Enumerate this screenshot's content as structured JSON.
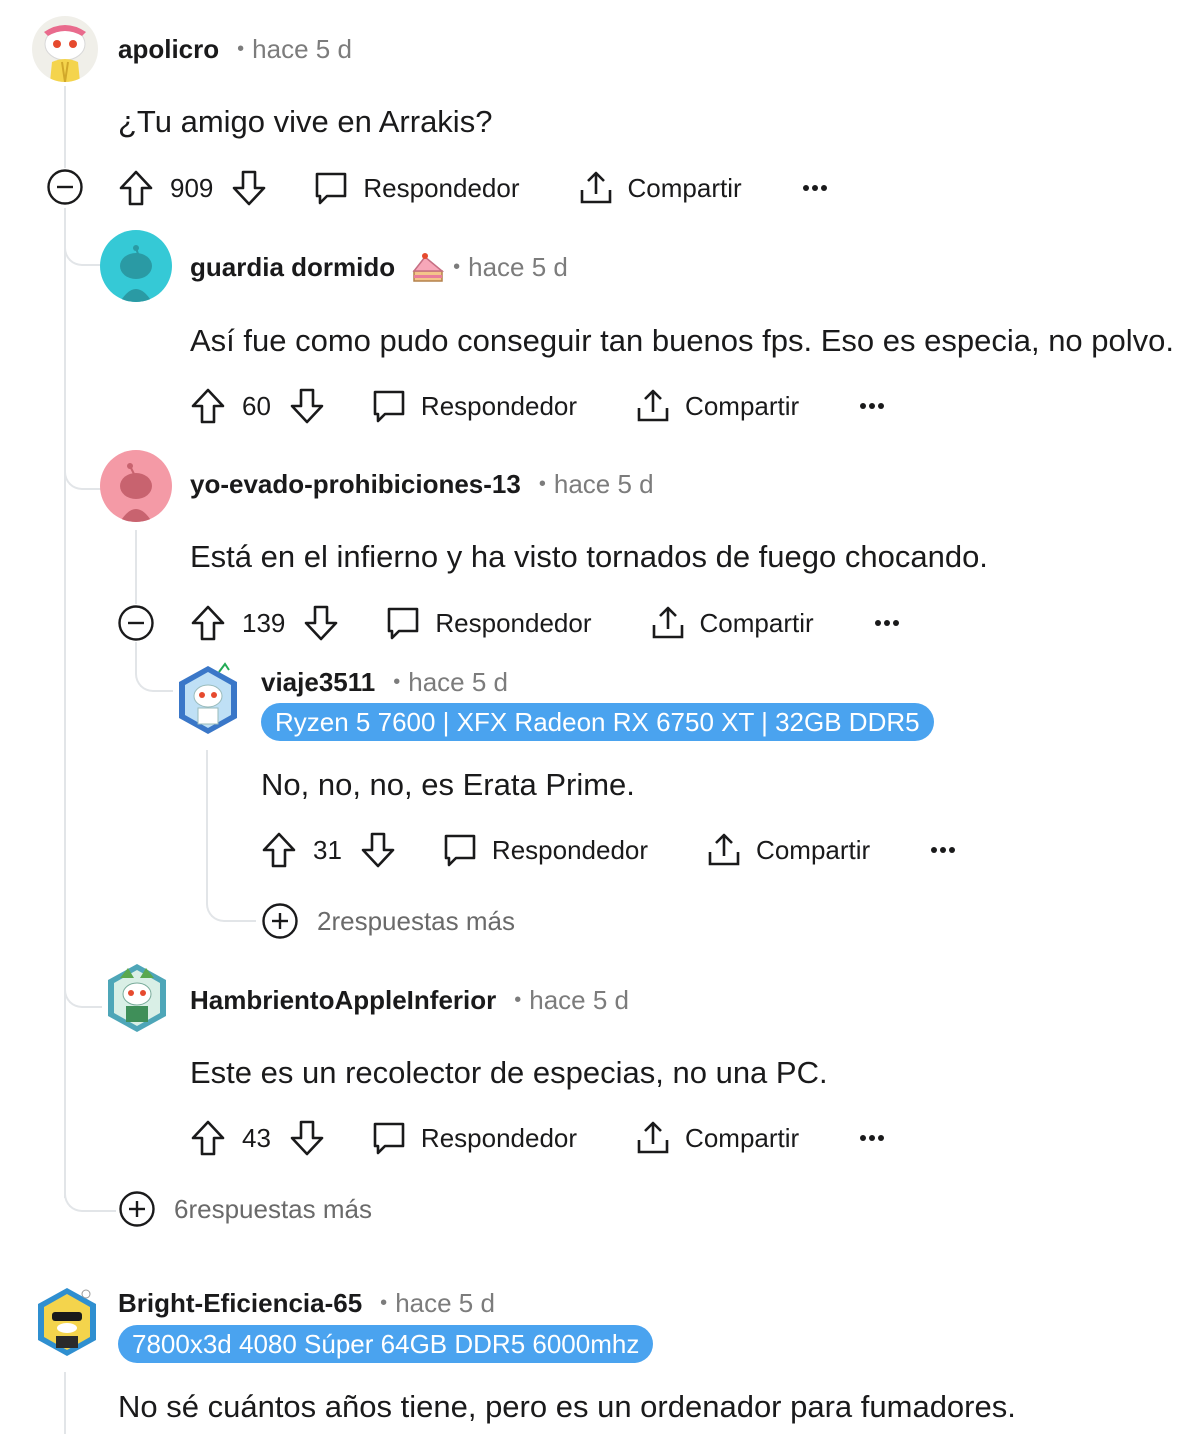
{
  "comments": [
    {
      "user": "apolicro",
      "time": "hace 5 d",
      "body": "¿Tu amigo vive en Arrakis?",
      "votes": "909",
      "reply_label": "Respondedor",
      "share_label": "Compartir",
      "avatar_color": "#f0efe9"
    },
    {
      "user": "guardia dormido",
      "time": "hace 5 d",
      "body": "Así fue como pudo conseguir tan buenos fps. Eso es especia, no polvo.",
      "votes": "60",
      "reply_label": "Respondedor",
      "share_label": "Compartir",
      "avatar_color": "#35c9d6"
    },
    {
      "user": "yo-evado-prohibiciones-13",
      "time": "hace 5 d",
      "body": "Está en el infierno y ha visto tornados de fuego chocando.",
      "votes": "139",
      "reply_label": "Respondedor",
      "share_label": "Compartir",
      "avatar_color": "#f49aa6"
    },
    {
      "user": "viaje3511",
      "time": "hace 5 d",
      "flair": "Ryzen 5 7600 | XFX Radeon RX 6750 XT | 32GB DDR5",
      "body": "No, no, no, es Erata Prime.",
      "votes": "31",
      "reply_label": "Respondedor",
      "share_label": "Compartir",
      "avatar_color": "#3a77c8"
    },
    {
      "user": "HambrientoAppleInferior",
      "time": "hace 5 d",
      "body": "Este es un recolector de especias, no una PC.",
      "votes": "43",
      "reply_label": "Respondedor",
      "share_label": "Compartir",
      "avatar_color": "#4ea6b8"
    },
    {
      "user": "Bright-Eficiencia-65",
      "time": "hace 5 d",
      "flair": "7800x3d 4080 Súper 64GB DDR5 6000mhz",
      "body": "No sé cuántos años tiene, pero es un ordenador para fumadores.",
      "avatar_color": "#2f8fd0"
    }
  ],
  "more_replies": [
    {
      "label": "2respuestas más"
    },
    {
      "label": "6respuestas más"
    }
  ],
  "colors": {
    "flair_bg": "#4aa3ef",
    "thread_line": "#e2e5e8",
    "meta_text": "#7c7c7c"
  }
}
